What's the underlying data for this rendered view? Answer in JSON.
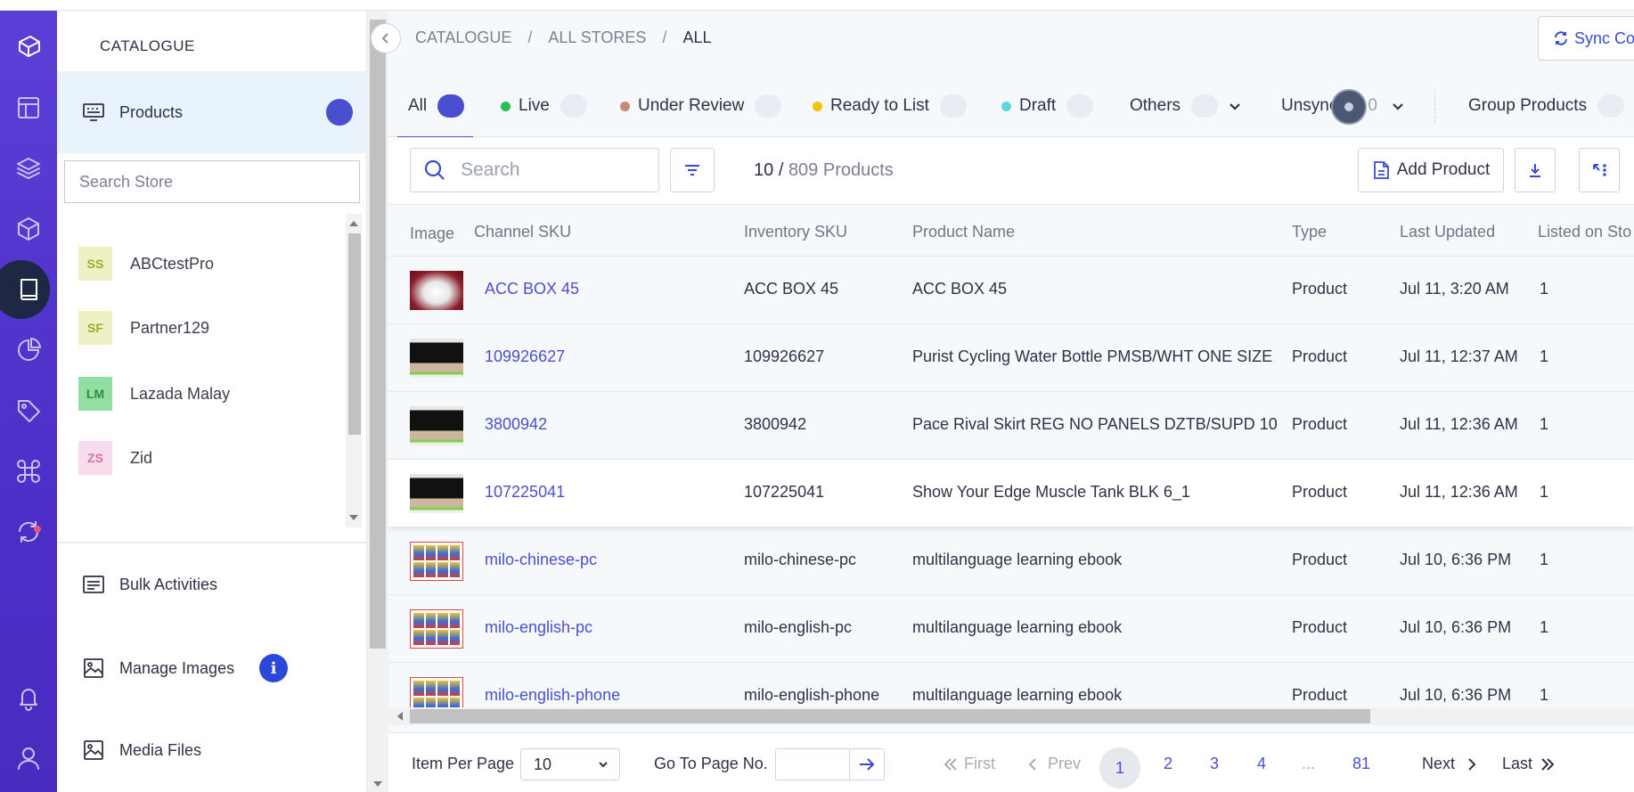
{
  "breadcrumb": [
    "CATALOGUE",
    "ALL STORES",
    "ALL"
  ],
  "sync_button": "Sync Co",
  "sidebar": {
    "title": "CATALOGUE",
    "products_label": "Products",
    "store_search_placeholder": "Search Store",
    "stores": [
      {
        "initials": "SS",
        "name": "ABCtestPro",
        "bg": "#eef1c4",
        "fg": "#a0a830"
      },
      {
        "initials": "SF",
        "name": "Partner129",
        "bg": "#eef1c4",
        "fg": "#a0a830"
      },
      {
        "initials": "LM",
        "name": "Lazada Malay",
        "bg": "#93dfa3",
        "fg": "#2e8a46"
      },
      {
        "initials": "ZS",
        "name": "Zid",
        "bg": "#f8dcec",
        "fg": "#d970aa"
      }
    ],
    "links": {
      "bulk": "Bulk Activities",
      "images": "Manage Images",
      "images_badge": "i",
      "media": "Media Files"
    }
  },
  "tabs": [
    {
      "label": "All",
      "dot": null,
      "active": true
    },
    {
      "label": "Live",
      "dot": "#2bbf4f"
    },
    {
      "label": "Under Review",
      "dot": "#c48a7a"
    },
    {
      "label": "Ready to List",
      "dot": "#f2c400"
    },
    {
      "label": "Draft",
      "dot": "#5ed8d8"
    },
    {
      "label": "Others",
      "dot": null,
      "dropdown": true
    },
    {
      "label": "Unsync",
      "dot": null,
      "dropdown": true,
      "count_fragment": "0"
    },
    {
      "label": "Group Products",
      "dot": null
    }
  ],
  "toolbar": {
    "search_placeholder": "Search",
    "shown": "10",
    "total": "809 Products",
    "add_product": "Add Product"
  },
  "table": {
    "headers": [
      "Image",
      "Channel SKU",
      "Inventory SKU",
      "Product Name",
      "Type",
      "Last Updated",
      "Listed on Sto"
    ],
    "rows": [
      {
        "image": "bag",
        "channel_sku": "ACC BOX 45",
        "inventory_sku": "ACC BOX 45",
        "name": "ACC BOX 45",
        "type": "Product",
        "updated": "Jul 11, 3:20 AM",
        "listed": "1"
      },
      {
        "image": "person",
        "channel_sku": "109926627",
        "inventory_sku": "109926627",
        "name": "Purist Cycling Water Bottle PMSB/WHT ONE SIZE",
        "type": "Product",
        "updated": "Jul 11, 12:37 AM",
        "listed": "1"
      },
      {
        "image": "person",
        "channel_sku": "3800942",
        "inventory_sku": "3800942",
        "name": "Pace Rival Skirt REG NO PANELS DZTB/SUPD 10",
        "type": "Product",
        "updated": "Jul 11, 12:36 AM",
        "listed": "1"
      },
      {
        "image": "person",
        "channel_sku": "107225041",
        "inventory_sku": "107225041",
        "name": "Show Your Edge Muscle Tank BLK 6_1",
        "type": "Product",
        "updated": "Jul 11, 12:36 AM",
        "listed": "1"
      },
      {
        "image": "ebook",
        "channel_sku": "milo-chinese-pc",
        "inventory_sku": "milo-chinese-pc",
        "name": "multilanguage learning ebook",
        "type": "Product",
        "updated": "Jul 10, 6:36 PM",
        "listed": "1"
      },
      {
        "image": "ebook",
        "channel_sku": "milo-english-pc",
        "inventory_sku": "milo-english-pc",
        "name": "multilanguage learning ebook",
        "type": "Product",
        "updated": "Jul 10, 6:36 PM",
        "listed": "1"
      },
      {
        "image": "ebook",
        "channel_sku": "milo-english-phone",
        "inventory_sku": "milo-english-phone",
        "name": "multilanguage learning ebook",
        "type": "Product",
        "updated": "Jul 10, 6:36 PM",
        "listed": "1"
      }
    ]
  },
  "footer": {
    "per_page_label": "Item Per Page",
    "per_page_value": "10",
    "goto_label": "Go To Page No.",
    "first": "First",
    "prev": "Prev",
    "pages": [
      "1",
      "2",
      "3",
      "4",
      "...",
      "81"
    ],
    "current_page": "1",
    "next": "Next",
    "last": "Last"
  }
}
